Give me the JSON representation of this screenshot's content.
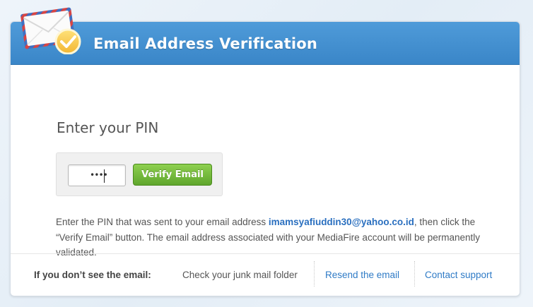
{
  "header": {
    "title": "Email Address Verification",
    "icon": "envelope-check-icon"
  },
  "pin": {
    "heading": "Enter your PIN",
    "input_value": "••••",
    "button_label": "Verify Email"
  },
  "description": {
    "part1": "Enter the PIN that was sent to your email address ",
    "email": "imamsyafiuddin30@yahoo.co.id",
    "part2": ", then click the “Verify Email” button. The email address associated with your MediaFire account will be permanently validated."
  },
  "footer": {
    "label": "If you don’t see the email:",
    "junk_text": "Check your junk mail folder",
    "resend_link": "Resend the email",
    "support_link": "Contact support"
  },
  "colors": {
    "header_blue": "#3a86c8",
    "button_green": "#5fa62d",
    "link_blue": "#2f7bc6"
  }
}
